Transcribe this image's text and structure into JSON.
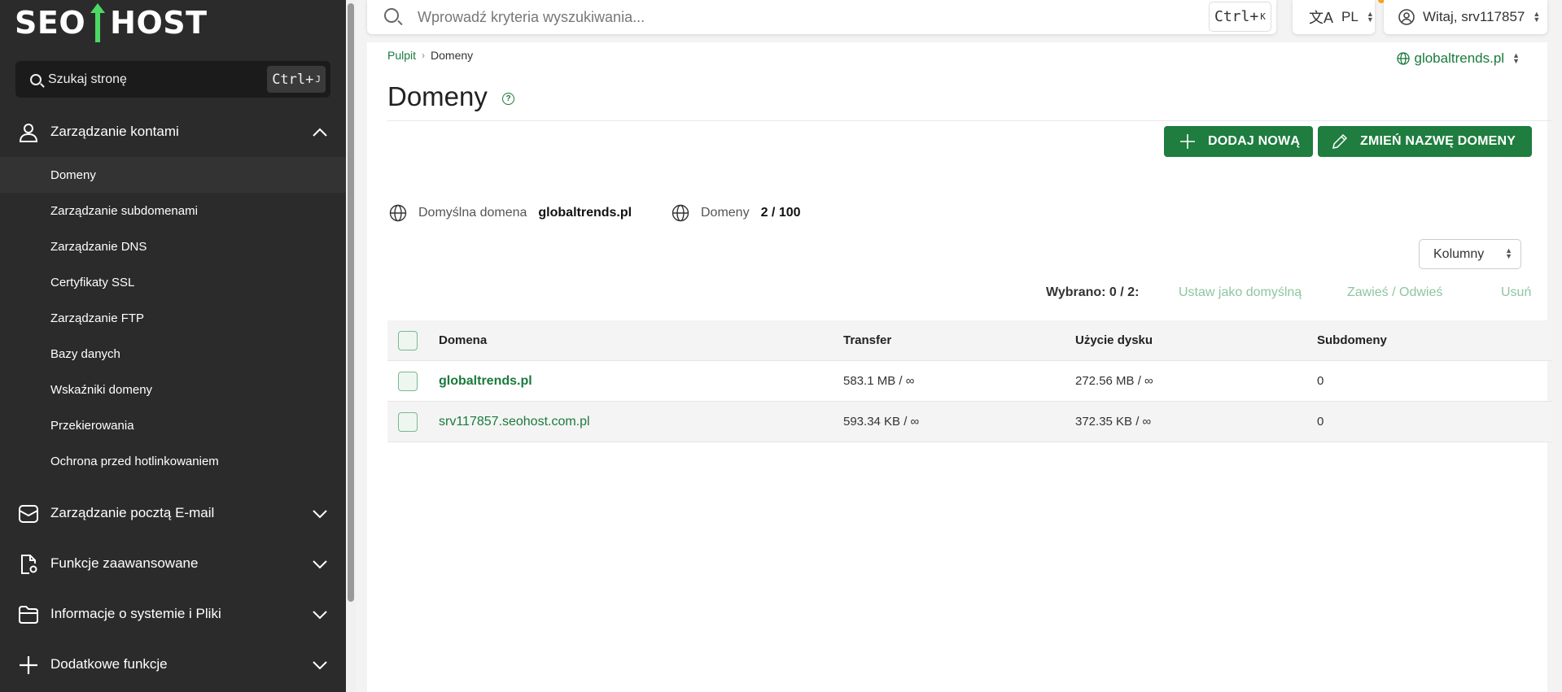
{
  "logo": {
    "text_left": "SEO",
    "text_right": "HOST"
  },
  "sidebar": {
    "search_label": "Szukaj stronę",
    "search_kbd_main": "Ctrl+",
    "search_kbd_key": "J",
    "account_section": "Zarządzanie kontami",
    "items": [
      {
        "label": "Domeny",
        "active": true
      },
      {
        "label": "Zarządzanie subdomenami"
      },
      {
        "label": "Zarządzanie DNS"
      },
      {
        "label": "Certyfikaty SSL"
      },
      {
        "label": "Zarządzanie FTP"
      },
      {
        "label": "Bazy danych"
      },
      {
        "label": "Wskaźniki domeny"
      },
      {
        "label": "Przekierowania"
      },
      {
        "label": "Ochrona przed hotlinkowaniem"
      }
    ],
    "sections": [
      {
        "label": "Zarządzanie pocztą E-mail",
        "icon": "mail-icon"
      },
      {
        "label": "Funkcje zaawansowane",
        "icon": "doc-gear-icon"
      },
      {
        "label": "Informacje o systemie i Pliki",
        "icon": "folder-icon"
      },
      {
        "label": "Dodatkowe funkcje",
        "icon": "plus-icon"
      }
    ]
  },
  "topbar": {
    "search_placeholder": "Wprowadź kryteria wyszukiwania...",
    "kbd_main": "Ctrl+",
    "kbd_key": "K",
    "language": "PL",
    "user_greeting": "Witaj, srv117857"
  },
  "breadcrumb": {
    "root": "Pulpit",
    "current": "Domeny"
  },
  "domain_selector": "globaltrends.pl",
  "page_title": "Domeny",
  "buttons": {
    "add": "DODAJ NOWĄ",
    "rename": "ZMIEŃ NAZWĘ DOMENY"
  },
  "info": {
    "default_label": "Domyślna domena",
    "default_value": "globaltrends.pl",
    "count_label": "Domeny",
    "count_value": "2 / 100"
  },
  "columns_button": "Kolumny",
  "bulk": {
    "selected": "Wybrano: 0 / 2:",
    "set_default": "Ustaw jako domyślną",
    "suspend": "Zawieś / Odwieś",
    "delete": "Usuń"
  },
  "table": {
    "headers": [
      "Domena",
      "Transfer",
      "Użycie dysku",
      "Subdomeny"
    ],
    "rows": [
      {
        "domain": "globaltrends.pl",
        "transfer": "583.1 MB / ∞",
        "disk": "272.56 MB / ∞",
        "subdomains": "0"
      },
      {
        "domain": "srv117857.seohost.com.pl",
        "transfer": "593.34 KB / ∞",
        "disk": "372.35 KB / ∞",
        "subdomains": "0"
      }
    ]
  },
  "colors": {
    "brand_green": "#1e7d3f",
    "sidebar_bg": "#2b2b2b",
    "logo_green": "#4cd964"
  }
}
